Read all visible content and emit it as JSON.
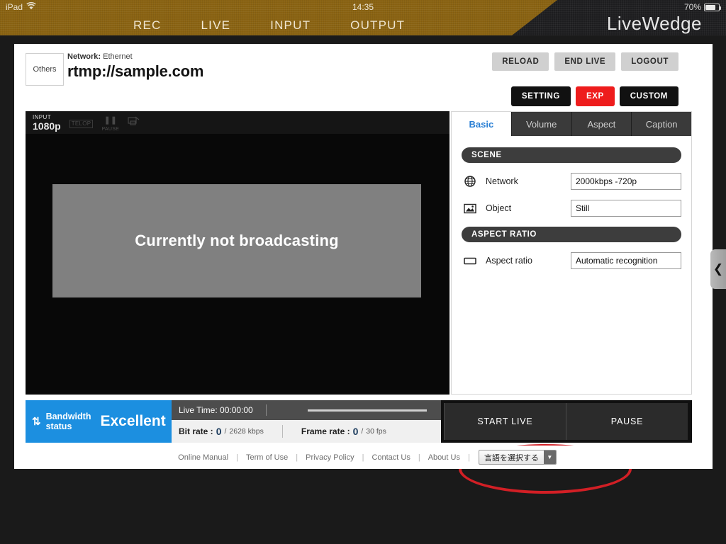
{
  "statusbar": {
    "device": "iPad",
    "wifi_icon": "wifi-icon",
    "time": "14:35",
    "battery_percent": "70%",
    "battery_icon": "battery-icon"
  },
  "nav": {
    "items": [
      {
        "label": "REC",
        "active": false
      },
      {
        "label": "LIVE",
        "active": true
      },
      {
        "label": "INPUT",
        "active": false
      },
      {
        "label": "OUTPUT",
        "active": false
      }
    ],
    "brand": "LiveWedge",
    "active_accent": "#29a4e0"
  },
  "header": {
    "badge": "Others",
    "network_key": "Network:",
    "network_value": "Ethernet",
    "url": "rtmp://sample.com",
    "top_buttons": [
      {
        "label": "RELOAD"
      },
      {
        "label": "END LIVE"
      },
      {
        "label": "LOGOUT"
      }
    ],
    "mid_buttons": [
      {
        "label": "SETTING",
        "color": "#111111"
      },
      {
        "label": "EXP",
        "color": "#ee1c1c"
      },
      {
        "label": "CUSTOM",
        "color": "#111111"
      }
    ]
  },
  "preview": {
    "input_label": "INPUT",
    "input_value": "1080p",
    "icons": [
      {
        "name": "telop-icon",
        "glyph": "TELOP",
        "caption": ""
      },
      {
        "name": "pause-icon",
        "glyph": "❚❚",
        "caption": "PAUSE"
      },
      {
        "name": "layout-icon",
        "glyph": "▧",
        "caption": ""
      }
    ],
    "message": "Currently not broadcasting"
  },
  "settings": {
    "tabs": [
      {
        "label": "Basic",
        "active": true
      },
      {
        "label": "Volume",
        "active": false
      },
      {
        "label": "Aspect",
        "active": false
      },
      {
        "label": "Caption",
        "active": false
      }
    ],
    "sections": [
      {
        "title": "SCENE",
        "fields": [
          {
            "icon": "globe-icon",
            "label": "Network",
            "value": "2000kbps -720p"
          },
          {
            "icon": "image-icon",
            "label": "Object",
            "value": "Still"
          }
        ]
      },
      {
        "title": "ASPECT RATIO",
        "fields": [
          {
            "icon": "rectangle-icon",
            "label": "Aspect ratio",
            "value": "Automatic recognition"
          }
        ]
      }
    ]
  },
  "status": {
    "bandwidth_label_line1": "Bandwidth",
    "bandwidth_label_line2": "status",
    "bandwidth_value": "Excellent",
    "bandwidth_color": "#1c8fe0",
    "live_time_label": "Live Time: 00:00:00",
    "bitrate_label": "Bit rate :",
    "bitrate_current": "0",
    "bitrate_sep": "/",
    "bitrate_max": "2628 kbps",
    "framerate_label": "Frame rate  :",
    "framerate_current": "0",
    "framerate_sep": "/",
    "framerate_max": "30 fps",
    "start_live": "START LIVE",
    "pause": "PAUSE",
    "annotation_color": "#d21f25"
  },
  "footer": {
    "links": [
      "Online Manual",
      "Term of Use",
      "Privacy Policy",
      "Contact Us",
      "About Us"
    ],
    "separator": "|",
    "language_select": "言語を選択する",
    "language_arrow": "▼"
  },
  "side_tab": {
    "icon": "chevron-left-icon",
    "glyph": "❮"
  }
}
